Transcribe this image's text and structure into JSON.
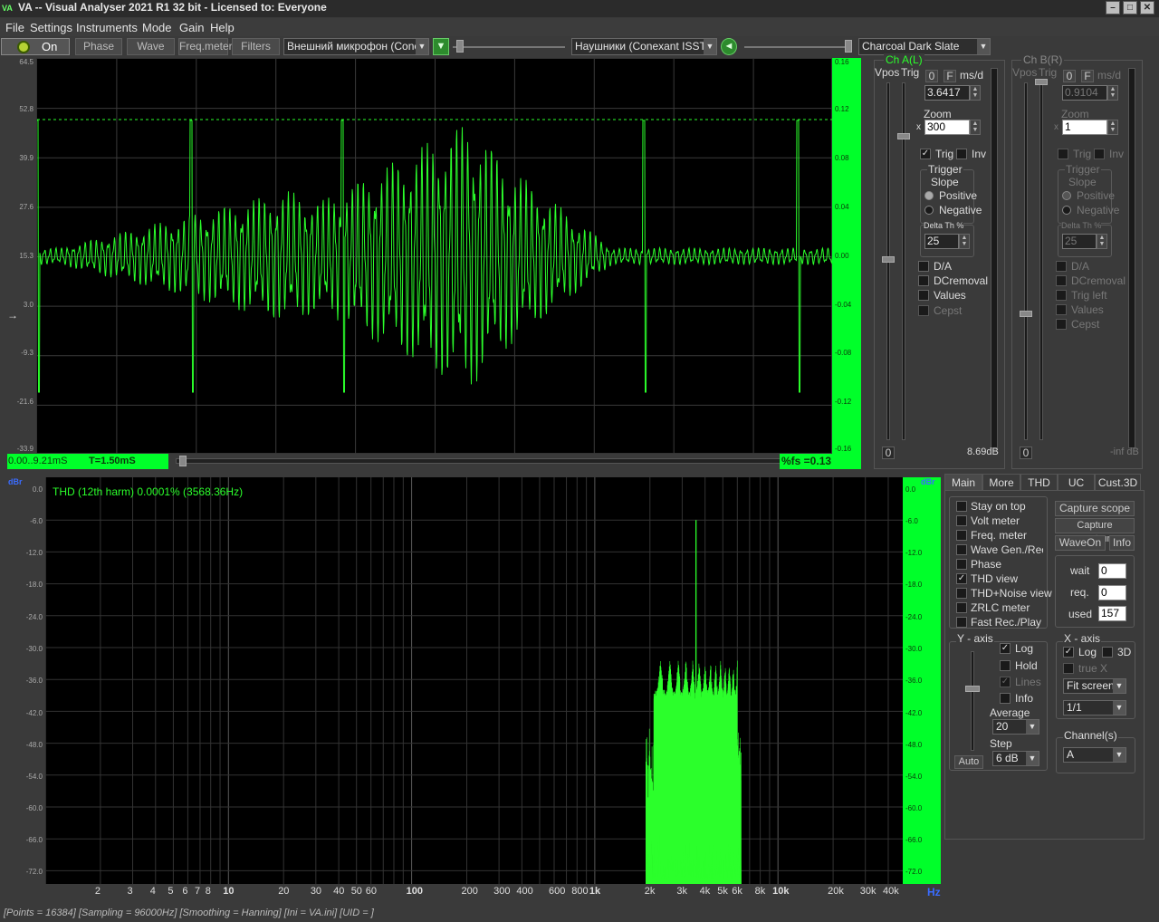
{
  "titlebar": {
    "logo": "VA",
    "title": "VA -- Visual Analyser 2021 R1 32 bit - Licensed to: Everyone"
  },
  "menu": [
    "File",
    "Settings",
    "Instruments",
    "Mode",
    "Gain",
    "Help"
  ],
  "toolbar": {
    "on_label": "On",
    "phase_label": "Phase",
    "wave_label": "Wave",
    "freqmeter_label": "Freq.meter",
    "filters_label": "Filters",
    "input_device": "Внешний микрофон (Conexa",
    "output_device": "Наушники (Conexant ISST Au",
    "theme": "Charcoal Dark Slate"
  },
  "scope": {
    "left_scale": [
      "64.5",
      "52.8",
      "39.9",
      "27.6",
      "15.3",
      "3.0",
      "-9.3",
      "-21.6",
      "-33.9"
    ],
    "right_scale": [
      "0.16",
      "0.12",
      "0.08",
      "0.04",
      "0.00",
      "-0.04",
      "-0.08",
      "-0.12",
      "-0.16"
    ],
    "time_range": "0.00..9.21mS",
    "period": "T=1.50mS",
    "fs_readout": "%fs =0.13"
  },
  "chA": {
    "title": "Ch A(L)",
    "vpos_label": "Vpos",
    "trig_label": "Trig",
    "zero_btn": "0",
    "f_btn": "F",
    "unit": "ms/d",
    "msd_value": "3.6417",
    "zoom_label": "Zoom",
    "zoom_x": "x",
    "zoom_value": "300",
    "trig_check": "Trig",
    "inv_check": "Inv",
    "trigger_group": "Trigger",
    "slope_label": "Slope",
    "positive": "Positive",
    "negative": "Negative",
    "delta_label": "Delta Th %",
    "delta_value": "25",
    "opts": [
      "D/A",
      "DCremoval",
      "Values",
      "Cepst"
    ],
    "vpos_readout": "0",
    "level_readout": "8.69dB"
  },
  "chB": {
    "title": "Ch B(R)",
    "vpos_label": "Vpos",
    "trig_label": "Trig",
    "zero_btn": "0",
    "f_btn": "F",
    "unit": "ms/d",
    "msd_value": "0.9104",
    "zoom_label": "Zoom",
    "zoom_x": "x",
    "zoom_value": "1",
    "trig_check": "Trig",
    "inv_check": "Inv",
    "trigger_group": "Trigger",
    "slope_label": "Slope",
    "positive": "Positive",
    "negative": "Negative",
    "delta_label": "Delta Th %",
    "delta_value": "25",
    "opts": [
      "D/A",
      "DCremoval",
      "Trig left",
      "Values",
      "Cepst"
    ],
    "vpos_readout": "0",
    "level_readout": "-inf dB"
  },
  "spectrum": {
    "unit_label": "dBr",
    "thd_text": "THD (12th harm) 0.0001% (3568.36Hz)",
    "y_scale": [
      "0.0",
      "-6.0",
      "-12.0",
      "-18.0",
      "-24.0",
      "-30.0",
      "-36.0",
      "-42.0",
      "-48.0",
      "-54.0",
      "-60.0",
      "-66.0",
      "-72.0"
    ],
    "x_labels": [
      "2",
      "3",
      "4",
      "5",
      "6",
      "7",
      "8",
      "10",
      "20",
      "30",
      "40",
      "50",
      "60",
      "100",
      "200",
      "300",
      "400",
      "600",
      "800",
      "1k",
      "2k",
      "3k",
      "4k",
      "5k",
      "6k",
      "8k",
      "10k",
      "20k",
      "30k",
      "40k"
    ],
    "x_unit": "Hz"
  },
  "tabs": [
    "Main",
    "More",
    "THD",
    "UC",
    "Cust.3D"
  ],
  "main_tab": {
    "checks": [
      "Stay on top",
      "Volt meter",
      "Freq. meter",
      "Wave Gen./Rec",
      "Phase",
      "THD view",
      "THD+Noise view",
      "ZRLC meter",
      "Fast Rec./Play"
    ],
    "capture_scope": "Capture scope",
    "capture_spectrum": "Capture spectrum",
    "waveon": "WaveOn",
    "info": "Info",
    "wait_label": "wait",
    "wait_value": "0",
    "req_label": "req.",
    "req_value": "0",
    "used_label": "used",
    "used_value": "157",
    "yaxis_group": "Y - axis",
    "log_label": "Log",
    "hold_label": "Hold",
    "lines_label": "Lines",
    "info_label": "Info",
    "average_label": "Average",
    "average_value": "20",
    "step_label": "Step",
    "step_value": "6 dB",
    "auto_label": "Auto",
    "xaxis_group": "X - axis",
    "xlog_label": "Log",
    "x3d_label": "3D",
    "truex_label": "true X",
    "fit_value": "Fit screen",
    "ratio_value": "1/1",
    "channels_group": "Channel(s)",
    "channel_value": "A"
  },
  "status": "[Points = 16384]  [Sampling = 96000Hz]  [Smoothing = Hanning]  [Ini = VA.ini]  [UID = ]",
  "colors": {
    "trace": "#2bff2b",
    "scale_bg": "#00ff2a",
    "accent_blue": "#3a6cff"
  }
}
